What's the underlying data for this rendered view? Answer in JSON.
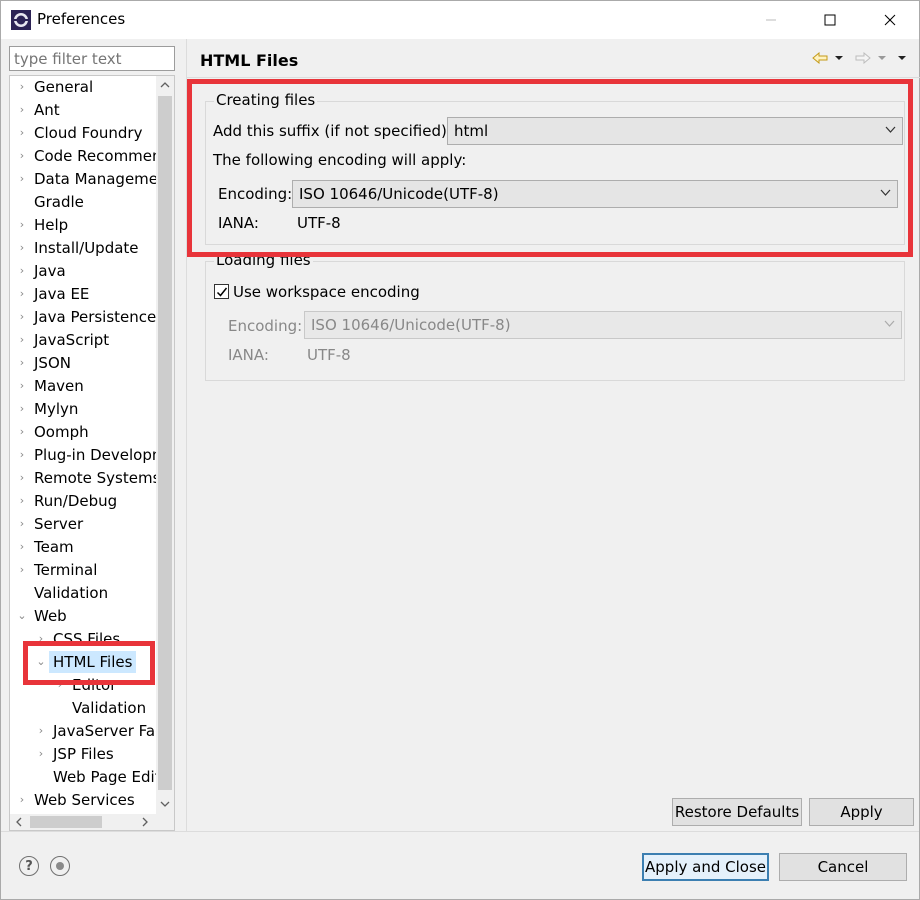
{
  "window": {
    "title": "Preferences"
  },
  "filter": {
    "placeholder": "type filter text"
  },
  "tree": {
    "items": [
      {
        "label": "General",
        "chev": "›"
      },
      {
        "label": "Ant",
        "chev": "›"
      },
      {
        "label": "Cloud Foundry",
        "chev": "›"
      },
      {
        "label": "Code Recommenders",
        "chev": "›"
      },
      {
        "label": "Data Management",
        "chev": "›"
      },
      {
        "label": "Gradle",
        "chev": ""
      },
      {
        "label": "Help",
        "chev": "›"
      },
      {
        "label": "Install/Update",
        "chev": "›"
      },
      {
        "label": "Java",
        "chev": "›"
      },
      {
        "label": "Java EE",
        "chev": "›"
      },
      {
        "label": "Java Persistence",
        "chev": "›"
      },
      {
        "label": "JavaScript",
        "chev": "›"
      },
      {
        "label": "JSON",
        "chev": "›"
      },
      {
        "label": "Maven",
        "chev": "›"
      },
      {
        "label": "Mylyn",
        "chev": "›"
      },
      {
        "label": "Oomph",
        "chev": "›"
      },
      {
        "label": "Plug-in Development",
        "chev": "›"
      },
      {
        "label": "Remote Systems",
        "chev": "›"
      },
      {
        "label": "Run/Debug",
        "chev": "›"
      },
      {
        "label": "Server",
        "chev": "›"
      },
      {
        "label": "Team",
        "chev": "›"
      },
      {
        "label": "Terminal",
        "chev": "›"
      },
      {
        "label": "Validation",
        "chev": ""
      },
      {
        "label": "Web",
        "chev": "⌄"
      },
      {
        "label": "CSS Files",
        "chev": "›"
      },
      {
        "label": "HTML Files",
        "chev": "⌄"
      },
      {
        "label": "Editor",
        "chev": "›"
      },
      {
        "label": "Validation",
        "chev": ""
      },
      {
        "label": "JavaServer Faces",
        "chev": "›"
      },
      {
        "label": "JSP Files",
        "chev": "›"
      },
      {
        "label": "Web Page Editor",
        "chev": ""
      },
      {
        "label": "Web Services",
        "chev": "›"
      }
    ]
  },
  "page": {
    "title": "HTML Files"
  },
  "creating": {
    "group_label": "Creating files",
    "suffix_label": "Add this suffix (if not specified):",
    "suffix_value": "html",
    "encoding_note": "The following encoding will apply:",
    "encoding_label": "Encoding:",
    "encoding_value": "ISO 10646/Unicode(UTF-8)",
    "iana_label": "IANA:",
    "iana_value": "UTF-8"
  },
  "loading": {
    "group_label": "Loading files",
    "use_workspace_label": "Use workspace encoding",
    "use_workspace_checked": true,
    "encoding_label": "Encoding:",
    "encoding_value": "ISO 10646/Unicode(UTF-8)",
    "iana_label": "IANA:",
    "iana_value": "UTF-8"
  },
  "buttons": {
    "restore_defaults": "Restore Defaults",
    "apply": "Apply",
    "apply_and_close": "Apply and Close",
    "cancel": "Cancel"
  },
  "colors": {
    "highlight": "#e8343a",
    "selection": "#cce8ff",
    "default_button_border": "#3c7fb1"
  }
}
